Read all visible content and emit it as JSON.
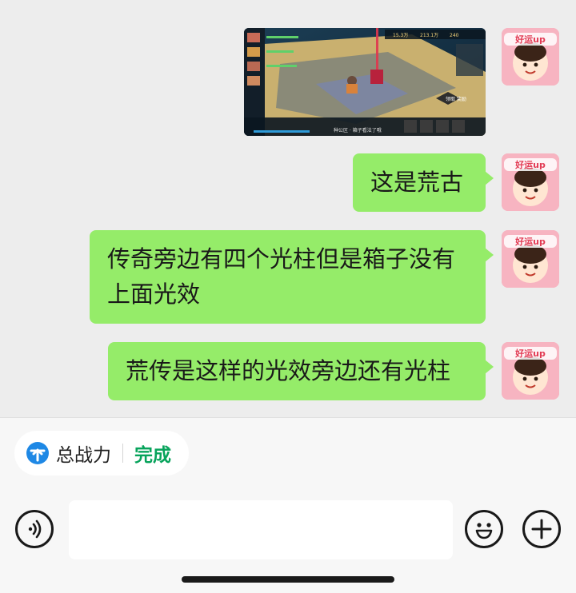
{
  "messages": [
    {
      "type": "image",
      "game_screenshot": {
        "top_bar": [
          "15.3万",
          "213.1万",
          "240"
        ],
        "side_label": "领取 奖励",
        "bottom_tip": "种公区 · 箱子看法了哦"
      }
    },
    {
      "type": "text",
      "text": "这是荒古"
    },
    {
      "type": "text",
      "line1": "传奇旁边有四个光柱但是箱子没有",
      "line2": "上面光效"
    },
    {
      "type": "text",
      "text": "荒传是这样的光效旁边还有光柱"
    }
  ],
  "avatar": {
    "sticker_text": "好运up"
  },
  "toolbar": {
    "chip_label": "总战力",
    "chip_status": "完成"
  },
  "input": {
    "placeholder": ""
  },
  "colors": {
    "bubble": "#95ec69",
    "chip_status": "#07a35b",
    "background": "#ededed"
  },
  "icons": {
    "voice": "voice-icon",
    "emoji": "emoji-icon",
    "add": "plus-icon",
    "chip": "up-arrow-icon"
  }
}
